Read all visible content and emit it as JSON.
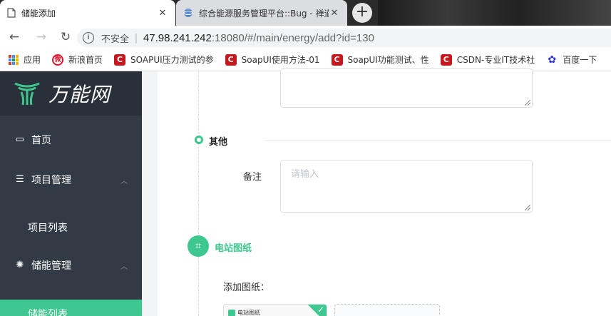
{
  "browser": {
    "tabs": [
      {
        "title": "储能添加",
        "close": "✕"
      },
      {
        "title": "综合能源服务管理平台::Bug - 禅道",
        "close": "✕"
      }
    ],
    "new_tab": "+",
    "nav": {
      "back": "←",
      "forward": "→",
      "reload": "↻"
    },
    "address": {
      "info": "i",
      "security_text": "不安全",
      "separator": "|",
      "host": "47.98.241.242",
      "rest": ":18080/#/main/energy/add?id=130"
    },
    "bookmarks": [
      {
        "label": "应用",
        "icon": "apps-icon"
      },
      {
        "label": "新浪首页",
        "icon": "weibo-icon",
        "glyph": "微"
      },
      {
        "label": "SOAPUI压力测试的参",
        "icon": "csdn-icon",
        "glyph": "C"
      },
      {
        "label": "SoapUI使用方法-01",
        "icon": "csdn-icon",
        "glyph": "C"
      },
      {
        "label": "SoapUI功能测试、性",
        "icon": "csdn-icon",
        "glyph": "C"
      },
      {
        "label": "CSDN-专业IT技术社",
        "icon": "csdn-icon",
        "glyph": "C"
      },
      {
        "label": "百度一下",
        "icon": "baidu-icon",
        "glyph": "✿"
      }
    ]
  },
  "sidebar": {
    "logo_text": "万能网",
    "items": [
      {
        "label": "首页",
        "icon": "laptop-icon",
        "glyph": "▭"
      },
      {
        "label": "项目管理",
        "icon": "list-icon",
        "glyph": "☰",
        "chevron": "︿"
      },
      {
        "label": "项目列表"
      },
      {
        "label": "储能管理",
        "icon": "bulb-icon",
        "glyph": "✺",
        "chevron": "︿"
      },
      {
        "label": "储能列表"
      }
    ]
  },
  "form": {
    "section_other": "其他",
    "remark_label": "备注",
    "remark_placeholder": "请输入",
    "drawings_title": "电站图纸",
    "drawings_icon": "map-icon",
    "drawings_glyph": "⌗",
    "upload_label": "添加图纸：",
    "thumb_caption": "电站图纸",
    "thumb_check": "✓"
  },
  "colors": {
    "accent": "#3ec890",
    "sidebar_bg": "#323a45"
  }
}
